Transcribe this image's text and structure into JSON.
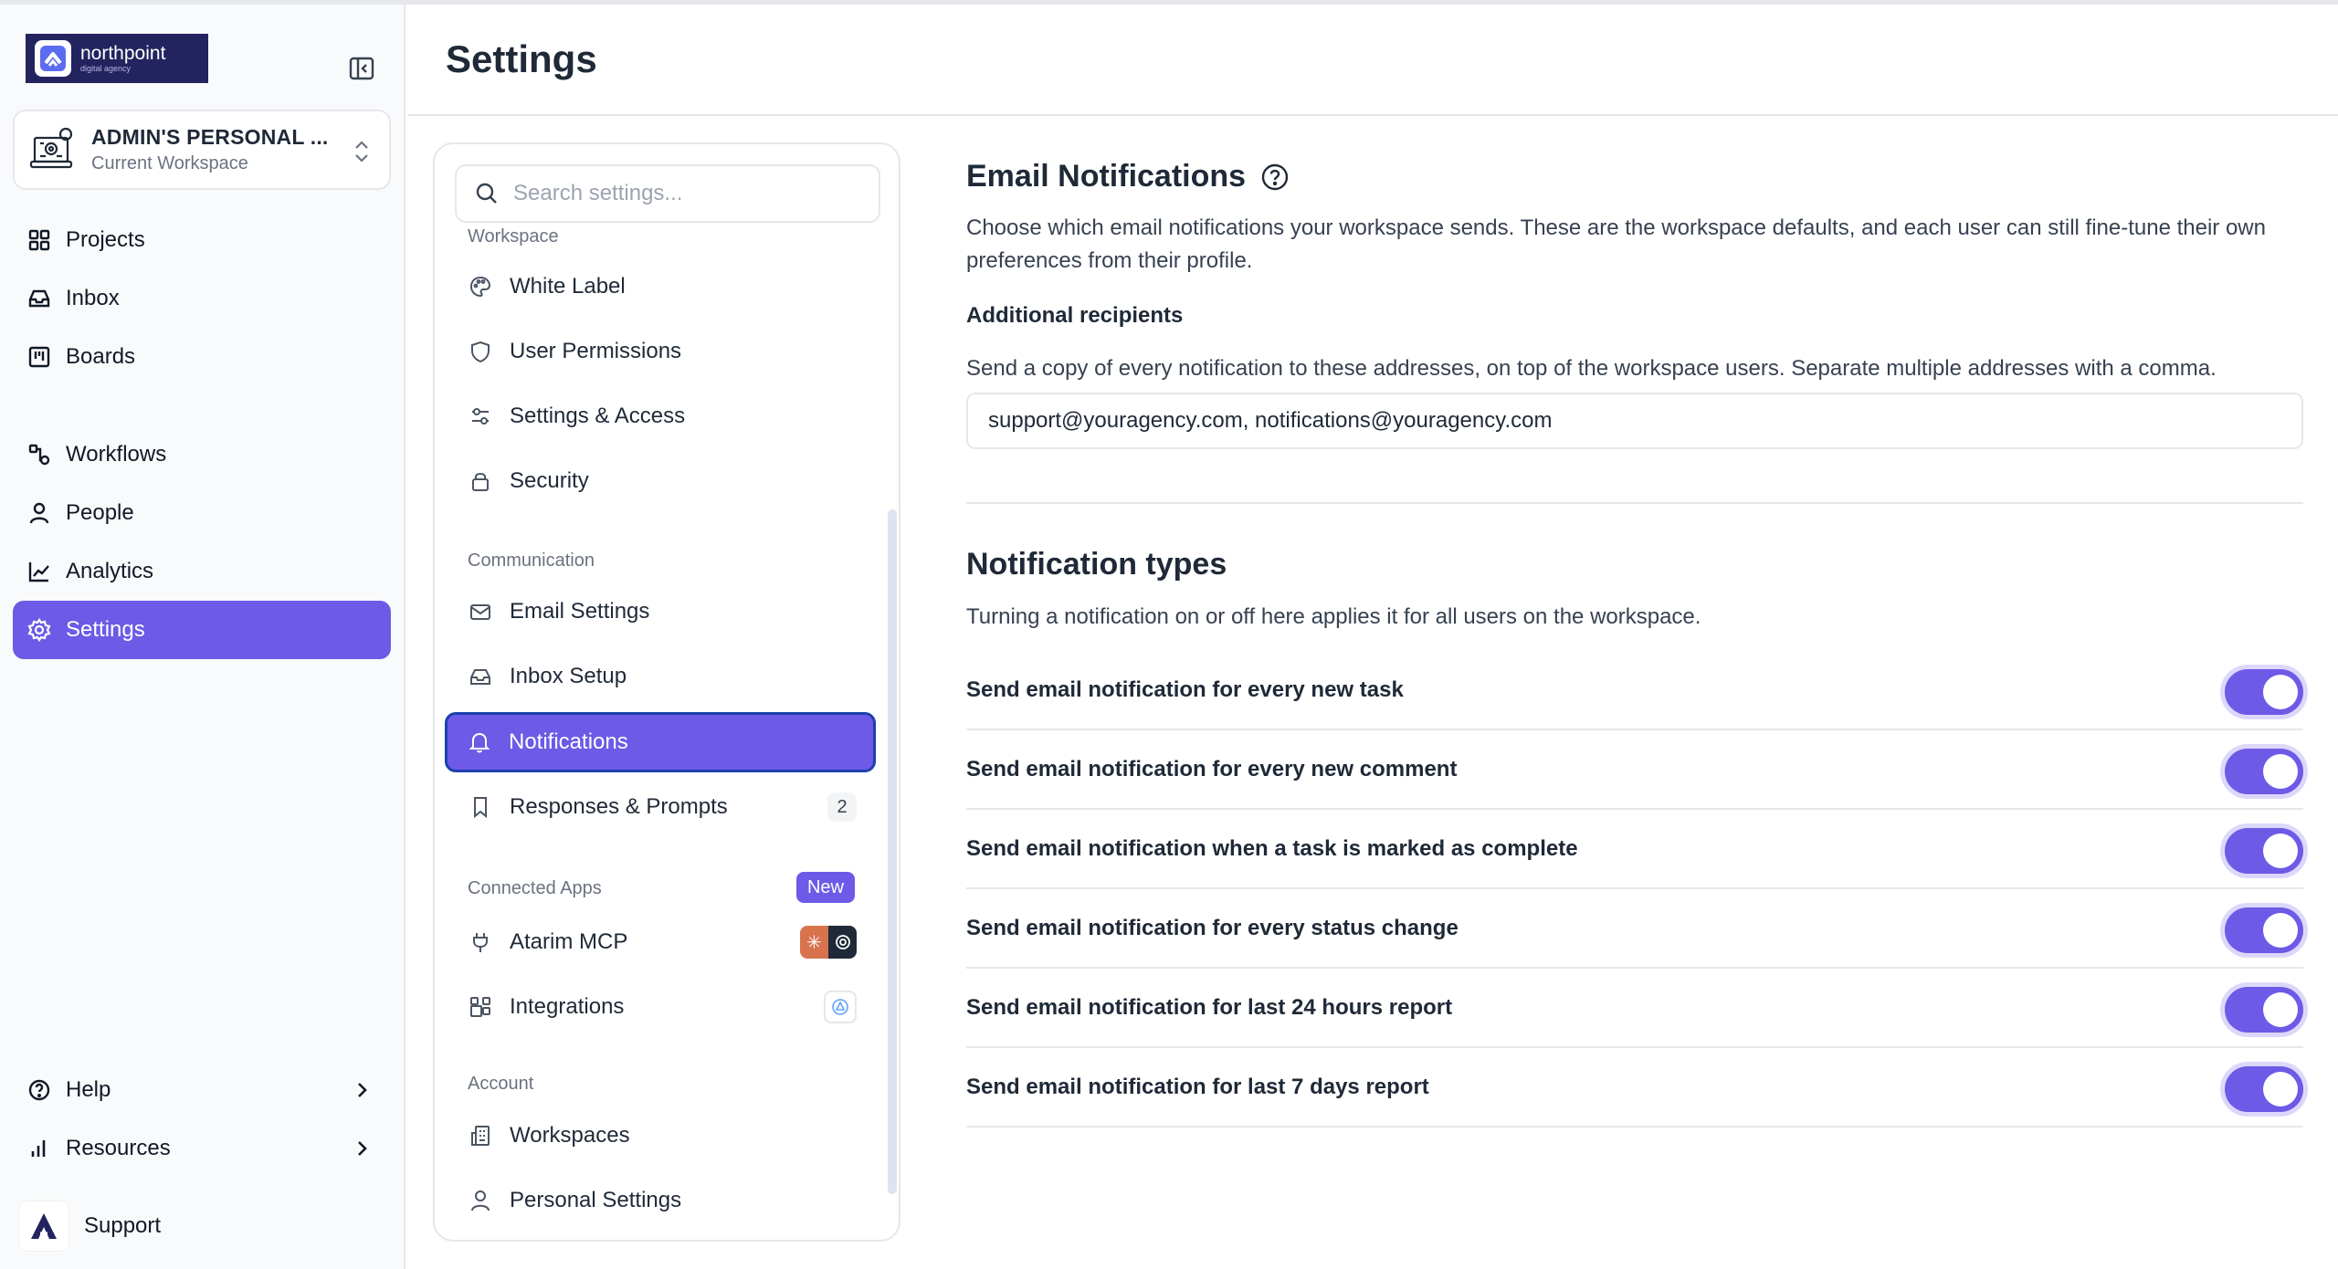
{
  "brand": {
    "name": "northpoint",
    "tagline": "digital agency"
  },
  "workspace": {
    "name": "ADMIN'S PERSONAL ...",
    "subtitle": "Current Workspace"
  },
  "sidebar": {
    "items": [
      {
        "label": "Projects",
        "icon": "grid-icon"
      },
      {
        "label": "Inbox",
        "icon": "inbox-icon"
      },
      {
        "label": "Boards",
        "icon": "board-icon"
      },
      {
        "label": "Workflows",
        "icon": "workflow-icon"
      },
      {
        "label": "People",
        "icon": "person-icon"
      },
      {
        "label": "Analytics",
        "icon": "chart-line-icon"
      },
      {
        "label": "Settings",
        "icon": "gear-icon",
        "active": true
      }
    ],
    "bottom": [
      {
        "label": "Help",
        "icon": "help-circle-icon"
      },
      {
        "label": "Resources",
        "icon": "bar-chart-icon"
      }
    ],
    "support_label": "Support"
  },
  "page": {
    "title": "Settings"
  },
  "settings_nav": {
    "search_placeholder": "Search settings...",
    "sections": {
      "workspace": "Workspace",
      "communication": "Communication",
      "connected_apps": "Connected Apps",
      "account": "Account"
    },
    "items": {
      "white_label": "White Label",
      "user_permissions": "User Permissions",
      "settings_access": "Settings & Access",
      "security": "Security",
      "email_settings": "Email Settings",
      "inbox_setup": "Inbox Setup",
      "notifications": "Notifications",
      "responses_prompts": "Responses & Prompts",
      "atarim_mcp": "Atarim MCP",
      "integrations": "Integrations",
      "workspaces": "Workspaces",
      "personal_settings": "Personal Settings"
    },
    "responses_count": "2",
    "new_badge": "New"
  },
  "email_notifications": {
    "title": "Email Notifications",
    "description": "Choose which email notifications your workspace sends. These are the workspace defaults, and each user can still fine-tune their own preferences from their profile.",
    "recipients_label": "Additional recipients",
    "recipients_help": "Send a copy of every notification to these addresses, on top of the workspace users. Separate multiple addresses with a comma.",
    "recipients_value": "support@youragency.com, notifications@youragency.com"
  },
  "notification_types": {
    "title": "Notification types",
    "description": "Turning a notification on or off here applies it for all users on the workspace.",
    "rows": [
      {
        "label": "Send email notification for every new task",
        "enabled": true
      },
      {
        "label": "Send email notification for every new comment",
        "enabled": true
      },
      {
        "label": "Send email notification when a task is marked as complete",
        "enabled": true
      },
      {
        "label": "Send email notification for every status change",
        "enabled": true
      },
      {
        "label": "Send email notification for last 24 hours report",
        "enabled": true
      },
      {
        "label": "Send email notification for last 7 days report",
        "enabled": true
      }
    ]
  },
  "colors": {
    "accent": "#6d5ae6",
    "brand_bg": "#23235f",
    "active_border": "#1e40af"
  }
}
